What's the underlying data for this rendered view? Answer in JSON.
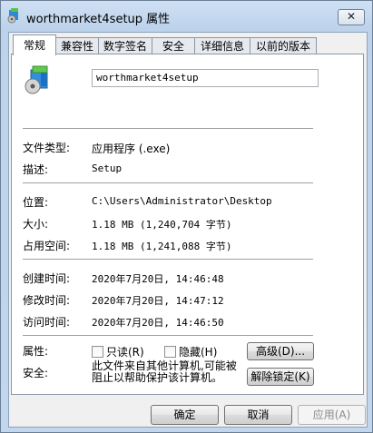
{
  "window": {
    "title": "worthmarket4setup 属性",
    "close_label": "✕"
  },
  "tabs": [
    "常规",
    "兼容性",
    "数字签名",
    "安全",
    "详细信息",
    "以前的版本"
  ],
  "general": {
    "file_name": "worthmarket4setup",
    "rows": [
      {
        "label": "文件类型:",
        "value": "应用程序 (.exe)"
      },
      {
        "label": "描述:",
        "value": "Setup"
      },
      {
        "label": "位置:",
        "value": "C:\\Users\\Administrator\\Desktop"
      },
      {
        "label": "大小:",
        "value": "1.18 MB (1,240,704 字节)"
      },
      {
        "label": "占用空间:",
        "value": "1.18 MB (1,241,088 字节)"
      },
      {
        "label": "创建时间:",
        "value": "2020年7月20日, 14:46:48"
      },
      {
        "label": "修改时间:",
        "value": "2020年7月20日, 14:47:12"
      },
      {
        "label": "访问时间:",
        "value": "2020年7月20日, 14:46:50"
      }
    ],
    "attributes_label": "属性:",
    "readonly_label": "只读(R)",
    "hidden_label": "隐藏(H)",
    "advanced_button": "高级(D)...",
    "security_label": "安全:",
    "security_text": "此文件来自其他计算机,可能被阻止以帮助保护该计算机。",
    "unblock_button": "解除锁定(K)"
  },
  "buttons": {
    "ok": "确定",
    "cancel": "取消",
    "apply": "应用(A)"
  }
}
